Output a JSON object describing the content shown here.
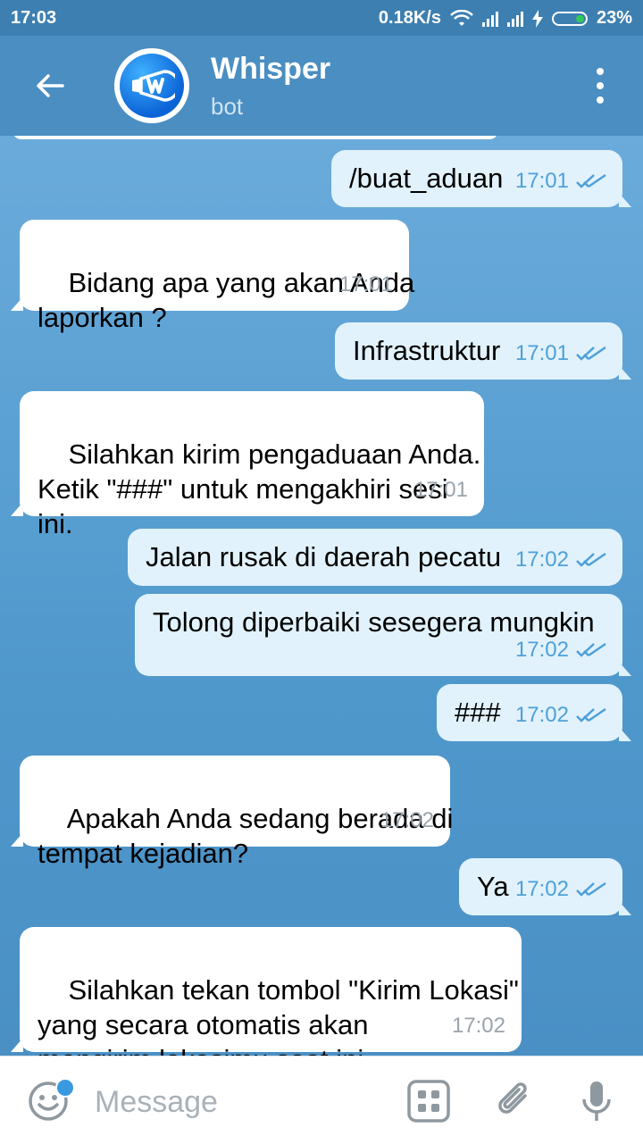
{
  "status_bar": {
    "time": "17:03",
    "network_speed": "0.18K/s",
    "battery_percent": "23%",
    "icons": [
      "wifi-icon",
      "signal-icon",
      "signal-icon",
      "charging-icon",
      "battery-icon"
    ]
  },
  "header": {
    "title": "Whisper",
    "subtitle": "bot",
    "icons": [
      "back-arrow-icon",
      "bot-avatar",
      "more-vert-icon"
    ]
  },
  "messages": [
    {
      "dir": "out",
      "text": "/buat_aduan",
      "time": "17:01",
      "read": true
    },
    {
      "dir": "in",
      "text": "Bidang apa yang akan Anda\nlaporkan ?",
      "time": "17:01"
    },
    {
      "dir": "out",
      "text": "Infrastruktur",
      "time": "17:01",
      "read": true
    },
    {
      "dir": "in",
      "text": "Silahkan kirim pengaduaan Anda.\nKetik \"###\" untuk mengakhiri sesi\nini.",
      "time": "17:01"
    },
    {
      "dir": "out",
      "text": "Jalan rusak di daerah pecatu",
      "time": "17:02",
      "read": true
    },
    {
      "dir": "out",
      "text": "Tolong diperbaiki sesegera mungkin",
      "time": "17:02",
      "read": true
    },
    {
      "dir": "out",
      "text": "###",
      "time": "17:02",
      "read": true
    },
    {
      "dir": "in",
      "text": "Apakah Anda sedang berada di\ntempat kejadian?",
      "time": "17:02"
    },
    {
      "dir": "out",
      "text": "Ya",
      "time": "17:02",
      "read": true
    },
    {
      "dir": "in",
      "text": "Silahkan tekan tombol \"Kirim Lokasi\"\nyang secara otomatis akan\nmengirim lokasimu saat ini.",
      "time": "17:02"
    }
  ],
  "input_bar": {
    "placeholder": "Message",
    "icons": [
      "emoji-icon",
      "bot-keyboard-icon",
      "attach-icon",
      "mic-icon"
    ]
  },
  "colors": {
    "header": "#4a8ec2",
    "status_bar": "#3d7fb1",
    "incoming_bubble": "#ffffff",
    "outgoing_bubble": "#e1f2fc",
    "check_marks": "#4ea0d8"
  }
}
